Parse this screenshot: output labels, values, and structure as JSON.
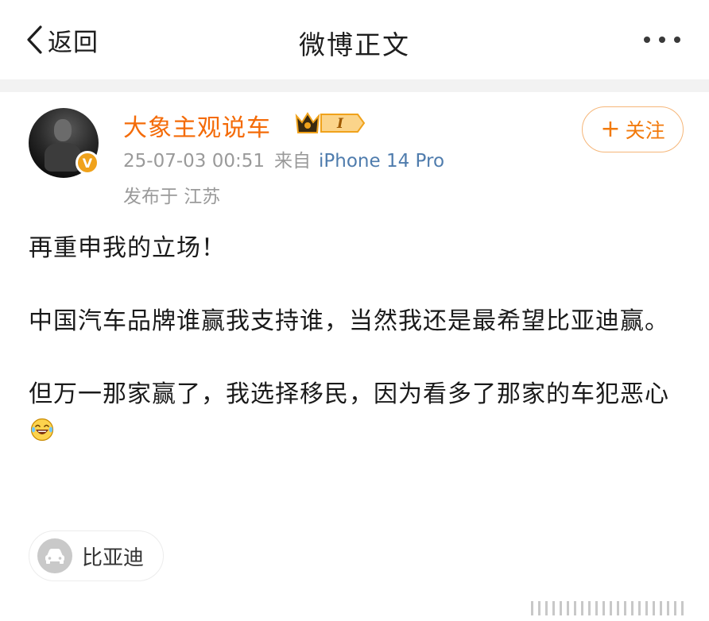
{
  "nav": {
    "back_label": "返回",
    "title": "微博正文"
  },
  "post": {
    "author": "大象主观说车",
    "badge_text": "I",
    "verified_badge": "V",
    "timestamp": "25-07-03 00:51",
    "from_label": "来自",
    "device": "iPhone 14 Pro",
    "location": "发布于 江苏",
    "follow_label": "关注",
    "paragraphs": [
      "再重申我的立场！",
      "中国汽车品牌谁赢我支持谁，当然我还是最希望比亚迪赢。",
      "但万一那家赢了，我选择移民，因为看多了那家的车犯恶心"
    ],
    "emoji": "laughing-tears-emoji",
    "topic_label": "比亚迪"
  },
  "colors": {
    "username": "#f46b08",
    "device": "#4f7cad",
    "meta": "#9a9a9a",
    "follow": "#f27a0c",
    "vip_badge": "#f0a21b"
  }
}
